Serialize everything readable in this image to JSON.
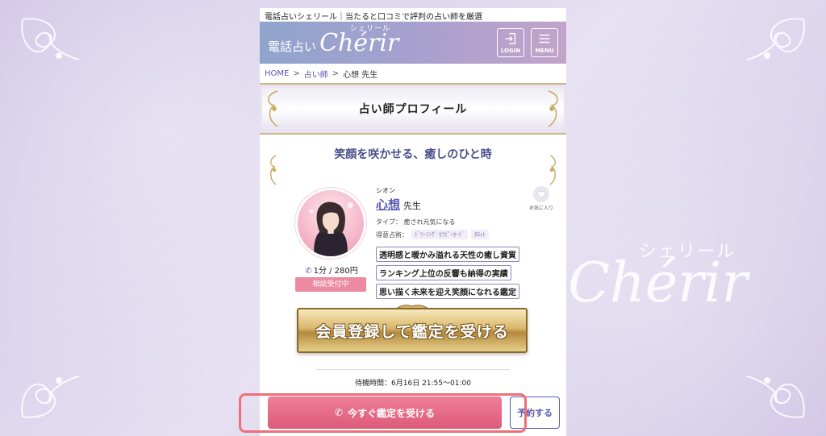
{
  "page": {
    "background_color": "#d9d0ea",
    "watermark": {
      "kana": "シェリール",
      "main": "Chérir"
    }
  },
  "site": {
    "tagline": "電話占いシェリール｜当たると口コミで評判の占い師を厳選",
    "brand_prefix": "電話占い",
    "brand_main": "Chérir",
    "brand_kana": "シェリール",
    "login_label": "LOGIN",
    "menu_label": "MENU",
    "header_gradient": [
      "#8fa4cc",
      "#c3a3c9"
    ]
  },
  "breadcrumb": {
    "items": [
      "HOME",
      "占い師",
      "心想 先生"
    ],
    "separator": ">"
  },
  "profile_title": "占い師プロフィール",
  "catchphrase": "笑顔を咲かせる、癒しのひと時",
  "fortune_teller": {
    "kana": "シオン",
    "name": "心想",
    "honorific": "先生",
    "type_label": "タイプ：",
    "type_value": "癒され元気になる",
    "skill_label": "得意占術：",
    "skills": [
      "ﾄﾞﾘｰﾐﾝｸﾞ ｾﾗﾋﾟｰｶｰﾄﾞ",
      "ﾀﾛｯﾄ"
    ],
    "features": [
      "透明感と暖かみ溢れる天性の癒し資質",
      "ランキング上位の反響も納得の実績",
      "思い描く未来を迎え笑顔になれる鑑定"
    ],
    "price": "1分 / 280円",
    "status": "相談受付中",
    "favorite_label": "お気に入り"
  },
  "cta": {
    "register_label": "会員登録して鑑定を受ける",
    "wait_time": "待機時間：6月16日 21:55～01:00",
    "call_now_label": "今すぐ鑑定を受ける",
    "reserve_label": "予約する"
  },
  "colors": {
    "accent": "#5a58b0",
    "call_button": "#e46683",
    "status_badge": "#ec8aa2",
    "highlight": "#ee6f75"
  }
}
